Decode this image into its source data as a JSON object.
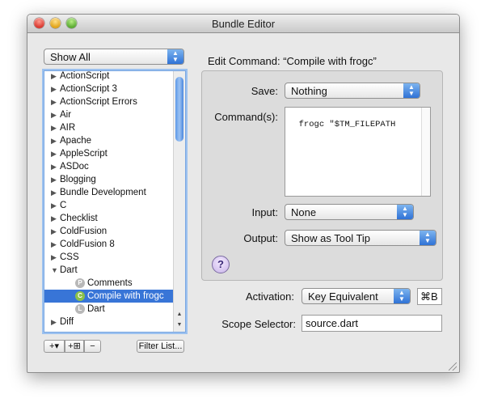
{
  "window": {
    "title": "Bundle Editor"
  },
  "filter_popup": {
    "value": "Show All"
  },
  "bundle_list": {
    "rows": [
      {
        "label": "ActionScript",
        "kind": "bundle"
      },
      {
        "label": "ActionScript 3",
        "kind": "bundle"
      },
      {
        "label": "ActionScript Errors",
        "kind": "bundle"
      },
      {
        "label": "Air",
        "kind": "bundle"
      },
      {
        "label": "AIR",
        "kind": "bundle"
      },
      {
        "label": "Apache",
        "kind": "bundle"
      },
      {
        "label": "AppleScript",
        "kind": "bundle"
      },
      {
        "label": "ASDoc",
        "kind": "bundle"
      },
      {
        "label": "Blogging",
        "kind": "bundle"
      },
      {
        "label": "Bundle Development",
        "kind": "bundle"
      },
      {
        "label": "C",
        "kind": "bundle"
      },
      {
        "label": "Checklist",
        "kind": "bundle"
      },
      {
        "label": "ColdFusion",
        "kind": "bundle"
      },
      {
        "label": "ColdFusion 8",
        "kind": "bundle"
      },
      {
        "label": "CSS",
        "kind": "bundle"
      },
      {
        "label": "Dart",
        "kind": "bundle",
        "expanded": true
      },
      {
        "label": "Comments",
        "kind": "child",
        "badge": "P"
      },
      {
        "label": "Compile with frogc",
        "kind": "child",
        "badge": "C",
        "selected": true
      },
      {
        "label": "Dart",
        "kind": "child",
        "badge": "L"
      },
      {
        "label": "Diff",
        "kind": "bundle"
      }
    ]
  },
  "list_buttons": {
    "add": "+▾",
    "add_group": "+⊞",
    "remove": "−",
    "filter": "Filter List..."
  },
  "editor": {
    "heading": "Edit Command: “Compile with frogc”",
    "save_label": "Save:",
    "save_value": "Nothing",
    "command_label": "Command(s):",
    "command_text": "frogc \"$TM_FILEPATH",
    "input_label": "Input:",
    "input_value": "None",
    "output_label": "Output:",
    "output_value": "Show as Tool Tip",
    "help": "?",
    "activation_label": "Activation:",
    "activation_value": "Key Equivalent",
    "key_equivalent": "⌘B",
    "scope_label": "Scope Selector:",
    "scope_value": "source.dart"
  },
  "colors": {
    "selection": "#3875d7",
    "accent_arrows": "#2f72d6"
  }
}
